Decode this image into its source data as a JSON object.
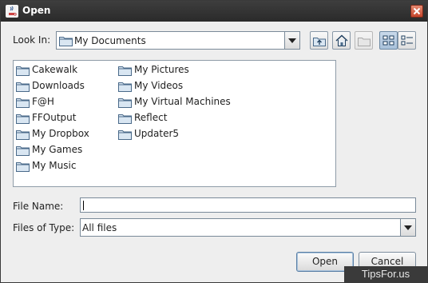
{
  "window": {
    "title": "Open"
  },
  "look_in": {
    "label": "Look In:",
    "selected": "My Documents",
    "toolbar": [
      {
        "name": "up-one-level",
        "icon": "folder-up-icon",
        "state": "enabled"
      },
      {
        "name": "home",
        "icon": "home-icon",
        "state": "enabled"
      },
      {
        "name": "new-folder",
        "icon": "new-folder-icon",
        "state": "disabled"
      },
      {
        "name": "list-view",
        "icon": "list-view-icon",
        "state": "pressed"
      },
      {
        "name": "details-view",
        "icon": "details-view-icon",
        "state": "enabled"
      }
    ]
  },
  "files": {
    "column1": [
      "Cakewalk",
      "Downloads",
      "F@H",
      "FFOutput",
      "My Dropbox",
      "My Games",
      "My Music"
    ],
    "column2": [
      "My Pictures",
      "My Videos",
      "My Virtual Machines",
      "Reflect",
      "Updater5"
    ]
  },
  "file_name": {
    "label": "File Name:",
    "value": ""
  },
  "files_of_type": {
    "label": "Files of Type:",
    "selected": "All files"
  },
  "buttons": {
    "open": "Open",
    "cancel": "Cancel"
  },
  "watermark": "TipsFor.us",
  "colors": {
    "folder": "#d9e6f2",
    "folder_stroke": "#4a6a8a",
    "close": "#c4452b"
  }
}
